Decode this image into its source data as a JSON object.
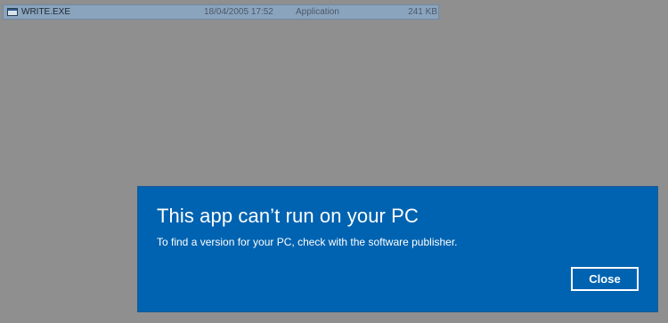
{
  "file_list": {
    "selected_row": {
      "icon": "application-window-icon",
      "name": "WRITE.EXE",
      "date_modified": "18/04/2005 17:52",
      "type": "Application",
      "size": "241 KB"
    }
  },
  "dialog": {
    "title": "This app can’t run on your PC",
    "message": "To find a version for your PC, check with the software publisher.",
    "close_label": "Close",
    "background_color": "#0063b1"
  },
  "colors": {
    "desktop_overlay": "#8f8f8f",
    "selection": "#8ba4bd"
  }
}
